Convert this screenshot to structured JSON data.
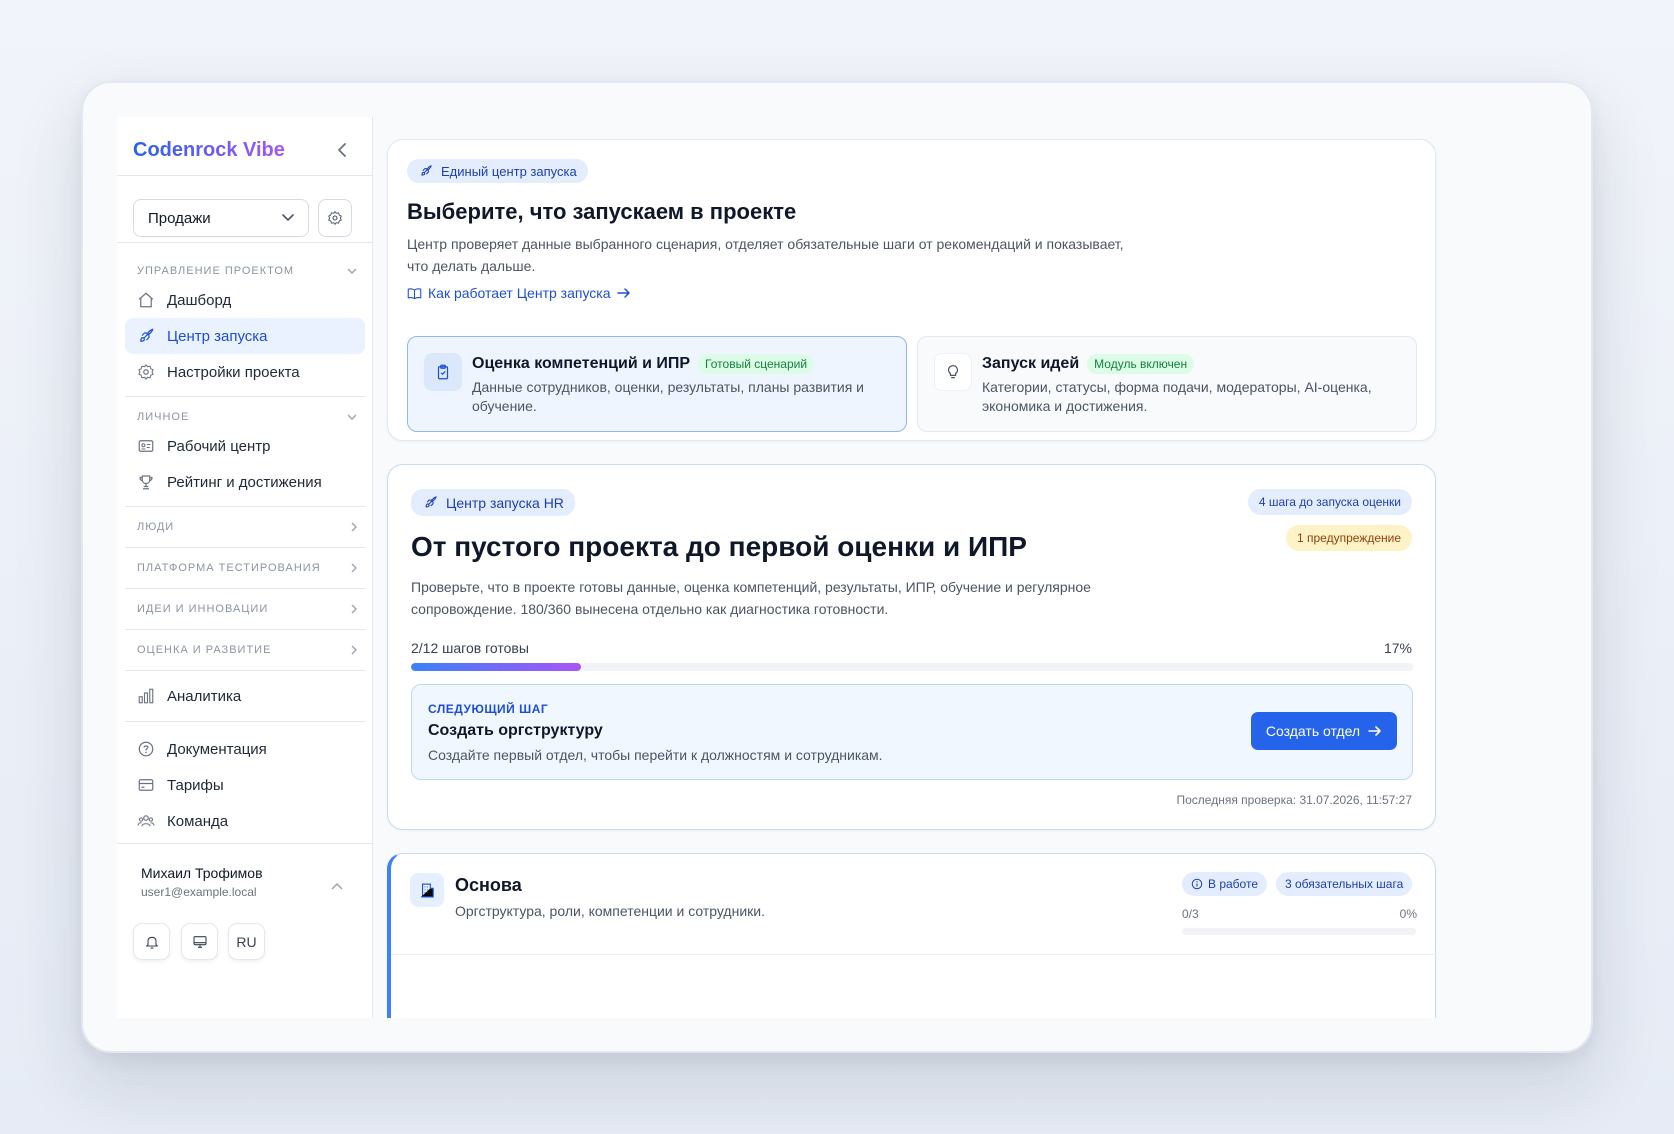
{
  "brand": "Codenrock Vibe",
  "sidebar": {
    "project_select": "Продажи",
    "sections": {
      "manage": "УПРАВЛЕНИЕ ПРОЕКТОМ",
      "personal": "ЛИЧНОЕ",
      "people": "ЛЮДИ",
      "testing": "ПЛАТФОРМА ТЕСТИРОВАНИЯ",
      "ideas": "ИДЕИ И ИННОВАЦИИ",
      "assessment": "ОЦЕНКА И РАЗВИТИЕ"
    },
    "items": {
      "dashboard": "Дашборд",
      "launch_center": "Центр запуска",
      "project_settings": "Настройки проекта",
      "work_center": "Рабочий центр",
      "rating": "Рейтинг и достижения",
      "analytics": "Аналитика",
      "docs": "Документация",
      "tariffs": "Тарифы",
      "team": "Команда"
    },
    "user": {
      "name": "Михаил Трофимов",
      "email": "user1@example.local",
      "lang": "RU"
    }
  },
  "hero": {
    "pill": "Единый центр запуска",
    "title": "Выберите, что запускаем в проекте",
    "desc1": "Центр проверяет данные выбранного сценария, отделяет обязательные шаги от рекомендаций и показывает,",
    "desc2": "что делать дальше.",
    "link": "Как работает Центр запуска",
    "options": [
      {
        "title": "Оценка компетенций и ИПР",
        "tag": "Готовый сценарий",
        "desc": "Данные сотрудников, оценки, результаты, планы развития и обучение."
      },
      {
        "title": "Запуск идей",
        "tag": "Модуль включен",
        "desc": "Категории, статусы, форма подачи, модераторы, AI-оценка, экономика и достижения."
      }
    ]
  },
  "hr_center": {
    "pill": "Центр запуска HR",
    "badge_steps": "4 шага до запуска оценки",
    "badge_warn": "1 предупреждение",
    "title": "От пустого проекта до первой оценки и ИПР",
    "desc1": "Проверьте, что в проекте готовы данные, оценка компетенций, результаты, ИПР, обучение и регулярное",
    "desc2": "сопровождение. 180/360 вынесена отдельно как диагностика готовности.",
    "progress_label": "2/12 шагов готовы",
    "progress_pct": "17%",
    "progress_value": 0.17,
    "next": {
      "kicker": "СЛЕДУЮЩИЙ ШАГ",
      "title": "Создать оргструктуру",
      "desc": "Создайте первый отдел, чтобы перейти к должностям и сотрудникам.",
      "button": "Создать отдел"
    },
    "last_check": "Последняя проверка: 31.07.2026, 11:57:27"
  },
  "basis": {
    "title": "Основа",
    "desc": "Оргструктура, роли, компетенции и сотрудники.",
    "badge_status": "В работе",
    "badge_count": "3 обязательных шага",
    "progress_label": "0/3",
    "progress_pct": "0%",
    "progress_value": 0
  },
  "colors": {
    "accent": "#2563eb",
    "brand_gradient_start": "#2563eb",
    "brand_gradient_end": "#a855f7",
    "success": "#15803d",
    "warning": "#92400e"
  }
}
